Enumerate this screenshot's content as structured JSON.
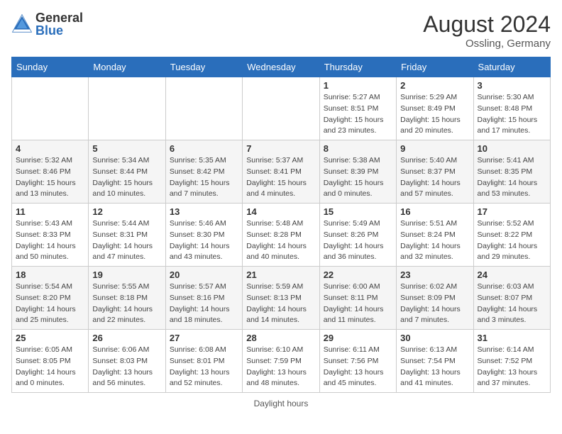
{
  "header": {
    "logo_general": "General",
    "logo_blue": "Blue",
    "month_year": "August 2024",
    "location": "Ossling, Germany"
  },
  "days_of_week": [
    "Sunday",
    "Monday",
    "Tuesday",
    "Wednesday",
    "Thursday",
    "Friday",
    "Saturday"
  ],
  "weeks": [
    [
      {
        "day": "",
        "detail": ""
      },
      {
        "day": "",
        "detail": ""
      },
      {
        "day": "",
        "detail": ""
      },
      {
        "day": "",
        "detail": ""
      },
      {
        "day": "1",
        "detail": "Sunrise: 5:27 AM\nSunset: 8:51 PM\nDaylight: 15 hours\nand 23 minutes."
      },
      {
        "day": "2",
        "detail": "Sunrise: 5:29 AM\nSunset: 8:49 PM\nDaylight: 15 hours\nand 20 minutes."
      },
      {
        "day": "3",
        "detail": "Sunrise: 5:30 AM\nSunset: 8:48 PM\nDaylight: 15 hours\nand 17 minutes."
      }
    ],
    [
      {
        "day": "4",
        "detail": "Sunrise: 5:32 AM\nSunset: 8:46 PM\nDaylight: 15 hours\nand 13 minutes."
      },
      {
        "day": "5",
        "detail": "Sunrise: 5:34 AM\nSunset: 8:44 PM\nDaylight: 15 hours\nand 10 minutes."
      },
      {
        "day": "6",
        "detail": "Sunrise: 5:35 AM\nSunset: 8:42 PM\nDaylight: 15 hours\nand 7 minutes."
      },
      {
        "day": "7",
        "detail": "Sunrise: 5:37 AM\nSunset: 8:41 PM\nDaylight: 15 hours\nand 4 minutes."
      },
      {
        "day": "8",
        "detail": "Sunrise: 5:38 AM\nSunset: 8:39 PM\nDaylight: 15 hours\nand 0 minutes."
      },
      {
        "day": "9",
        "detail": "Sunrise: 5:40 AM\nSunset: 8:37 PM\nDaylight: 14 hours\nand 57 minutes."
      },
      {
        "day": "10",
        "detail": "Sunrise: 5:41 AM\nSunset: 8:35 PM\nDaylight: 14 hours\nand 53 minutes."
      }
    ],
    [
      {
        "day": "11",
        "detail": "Sunrise: 5:43 AM\nSunset: 8:33 PM\nDaylight: 14 hours\nand 50 minutes."
      },
      {
        "day": "12",
        "detail": "Sunrise: 5:44 AM\nSunset: 8:31 PM\nDaylight: 14 hours\nand 47 minutes."
      },
      {
        "day": "13",
        "detail": "Sunrise: 5:46 AM\nSunset: 8:30 PM\nDaylight: 14 hours\nand 43 minutes."
      },
      {
        "day": "14",
        "detail": "Sunrise: 5:48 AM\nSunset: 8:28 PM\nDaylight: 14 hours\nand 40 minutes."
      },
      {
        "day": "15",
        "detail": "Sunrise: 5:49 AM\nSunset: 8:26 PM\nDaylight: 14 hours\nand 36 minutes."
      },
      {
        "day": "16",
        "detail": "Sunrise: 5:51 AM\nSunset: 8:24 PM\nDaylight: 14 hours\nand 32 minutes."
      },
      {
        "day": "17",
        "detail": "Sunrise: 5:52 AM\nSunset: 8:22 PM\nDaylight: 14 hours\nand 29 minutes."
      }
    ],
    [
      {
        "day": "18",
        "detail": "Sunrise: 5:54 AM\nSunset: 8:20 PM\nDaylight: 14 hours\nand 25 minutes."
      },
      {
        "day": "19",
        "detail": "Sunrise: 5:55 AM\nSunset: 8:18 PM\nDaylight: 14 hours\nand 22 minutes."
      },
      {
        "day": "20",
        "detail": "Sunrise: 5:57 AM\nSunset: 8:16 PM\nDaylight: 14 hours\nand 18 minutes."
      },
      {
        "day": "21",
        "detail": "Sunrise: 5:59 AM\nSunset: 8:13 PM\nDaylight: 14 hours\nand 14 minutes."
      },
      {
        "day": "22",
        "detail": "Sunrise: 6:00 AM\nSunset: 8:11 PM\nDaylight: 14 hours\nand 11 minutes."
      },
      {
        "day": "23",
        "detail": "Sunrise: 6:02 AM\nSunset: 8:09 PM\nDaylight: 14 hours\nand 7 minutes."
      },
      {
        "day": "24",
        "detail": "Sunrise: 6:03 AM\nSunset: 8:07 PM\nDaylight: 14 hours\nand 3 minutes."
      }
    ],
    [
      {
        "day": "25",
        "detail": "Sunrise: 6:05 AM\nSunset: 8:05 PM\nDaylight: 14 hours\nand 0 minutes."
      },
      {
        "day": "26",
        "detail": "Sunrise: 6:06 AM\nSunset: 8:03 PM\nDaylight: 13 hours\nand 56 minutes."
      },
      {
        "day": "27",
        "detail": "Sunrise: 6:08 AM\nSunset: 8:01 PM\nDaylight: 13 hours\nand 52 minutes."
      },
      {
        "day": "28",
        "detail": "Sunrise: 6:10 AM\nSunset: 7:59 PM\nDaylight: 13 hours\nand 48 minutes."
      },
      {
        "day": "29",
        "detail": "Sunrise: 6:11 AM\nSunset: 7:56 PM\nDaylight: 13 hours\nand 45 minutes."
      },
      {
        "day": "30",
        "detail": "Sunrise: 6:13 AM\nSunset: 7:54 PM\nDaylight: 13 hours\nand 41 minutes."
      },
      {
        "day": "31",
        "detail": "Sunrise: 6:14 AM\nSunset: 7:52 PM\nDaylight: 13 hours\nand 37 minutes."
      }
    ]
  ],
  "footer": {
    "daylight_hours_label": "Daylight hours"
  }
}
